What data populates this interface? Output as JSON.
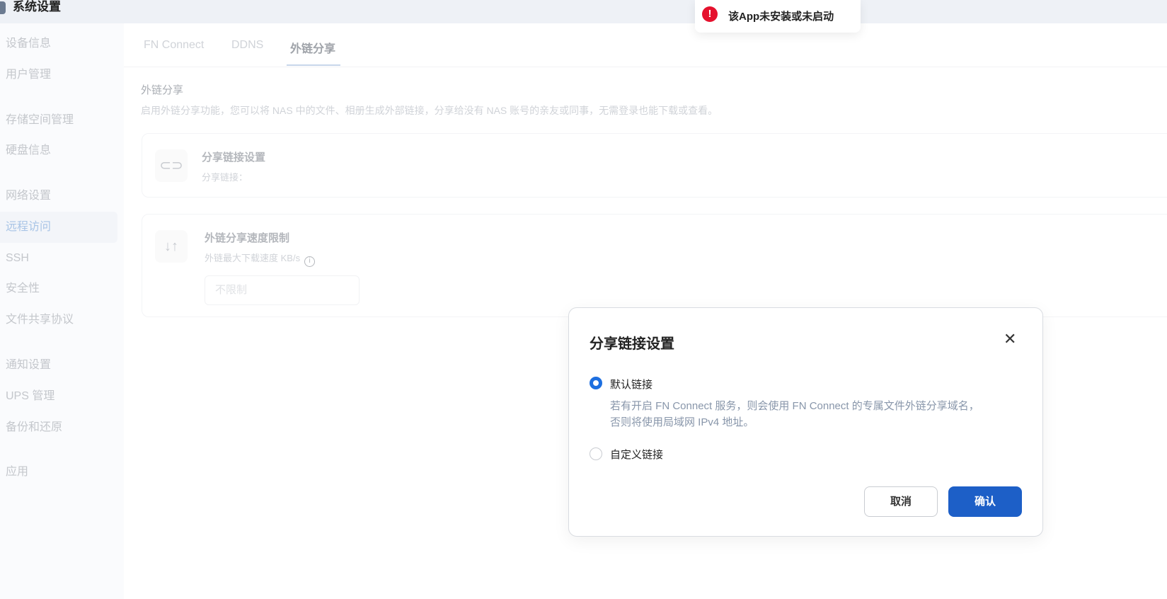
{
  "window": {
    "title": "系统设置"
  },
  "sidebar": {
    "items": [
      {
        "label": "设备信息"
      },
      {
        "label": "用户管理"
      },
      {
        "label": "存储空间管理"
      },
      {
        "label": "硬盘信息"
      },
      {
        "label": "网络设置"
      },
      {
        "label": "远程访问"
      },
      {
        "label": "SSH"
      },
      {
        "label": "安全性"
      },
      {
        "label": "文件共享协议"
      },
      {
        "label": "通知设置"
      },
      {
        "label": "UPS 管理"
      },
      {
        "label": "备份和还原"
      },
      {
        "label": "应用"
      }
    ]
  },
  "tabs": [
    {
      "label": "FN Connect"
    },
    {
      "label": "DDNS"
    },
    {
      "label": "外链分享"
    }
  ],
  "section": {
    "title": "外链分享",
    "desc": "启用外链分享功能，您可以将 NAS 中的文件、相册生成外部链接，分享给没有 NAS 账号的亲友或同事，无需登录也能下载或查看。"
  },
  "link_card": {
    "title": "分享链接设置",
    "sub": "分享链接："
  },
  "speed_card": {
    "title": "外链分享速度限制",
    "sub": "外链最大下载速度 KB/s",
    "input_placeholder": "不限制"
  },
  "toast": {
    "text": "该App未安装或未启动"
  },
  "modal": {
    "title": "分享链接设置",
    "options": [
      {
        "label": "默认链接",
        "selected": true,
        "desc1": "若有开启 FN Connect 服务，则会使用 FN Connect 的专属文件外链分享域名，",
        "desc2": "否则将使用局域网 IPv4 地址。"
      },
      {
        "label": "自定义链接",
        "selected": false
      }
    ],
    "cancel": "取消",
    "confirm": "确认"
  },
  "colors": {
    "accent": "#1d5fc7",
    "error": "#e5112d"
  }
}
